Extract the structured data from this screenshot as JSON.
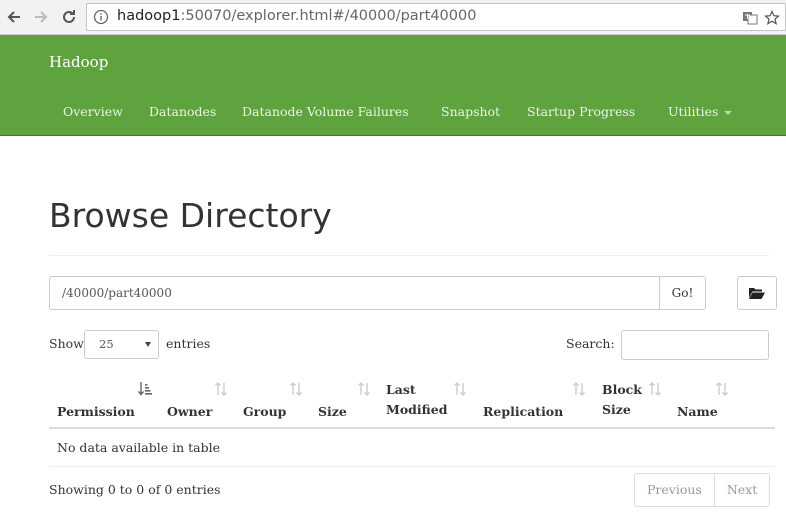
{
  "browser": {
    "url_host": "hadoop1",
    "url_rest": ":50070/explorer.html#/40000/part40000",
    "icons": [
      "back-icon",
      "forward-icon",
      "reload-icon",
      "info-icon",
      "translate-icon",
      "star-icon"
    ]
  },
  "navbar": {
    "brand": "Hadoop",
    "items": [
      "Overview",
      "Datanodes",
      "Datanode Volume Failures",
      "Snapshot",
      "Startup Progress",
      "Utilities"
    ],
    "color": "#5fa33e"
  },
  "main": {
    "title": "Browse Directory",
    "path_value": "/40000/part40000",
    "go_label": "Go!",
    "show_label": "Show",
    "entries_value": "25",
    "entries_label": "entries",
    "search_label": "Search:",
    "search_value": ""
  },
  "table": {
    "headers": [
      {
        "line1": "",
        "line2": "Permission"
      },
      {
        "line1": "",
        "line2": "Owner"
      },
      {
        "line1": "",
        "line2": "Group"
      },
      {
        "line1": "",
        "line2": "Size"
      },
      {
        "line1": "Last",
        "line2": "Modified"
      },
      {
        "line1": "",
        "line2": "Replication"
      },
      {
        "line1": "Block",
        "line2": "Size"
      },
      {
        "line1": "",
        "line2": "Name"
      }
    ],
    "empty_message": "No data available in table",
    "info": "Showing 0 to 0 of 0 entries",
    "previous_label": "Previous",
    "next_label": "Next"
  }
}
